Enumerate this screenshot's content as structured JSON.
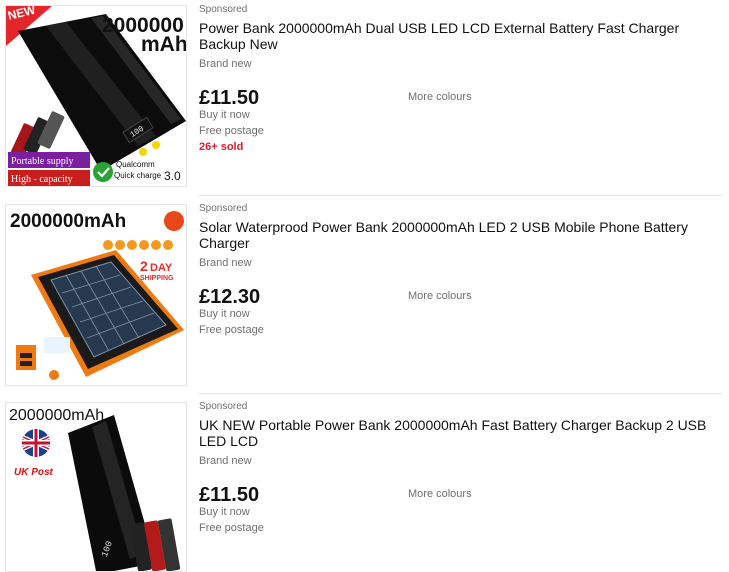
{
  "listings": [
    {
      "sponsored": "Sponsored",
      "title": "Power Bank 2000000mAh Dual USB LED LCD External Battery Fast Charger Backup New",
      "condition": "Brand new",
      "price": "£11.50",
      "format": "Buy it now",
      "postage": "Free postage",
      "sold": "26+ sold",
      "more": "More colours",
      "img": {
        "badge": "NEW",
        "cap_line1": "2000000",
        "cap_line2": "mAh",
        "tag1": "Portable supply",
        "tag2": "High - capacity",
        "qc_brand": "Qualcomm",
        "qc_text": "Quick charge",
        "qc_ver": "3.0",
        "lcd": "100"
      }
    },
    {
      "sponsored": "Sponsored",
      "title": "Solar Waterprood Power Bank 2000000mAh LED 2 USB Mobile Phone Battery Charger",
      "condition": "Brand new",
      "price": "£12.30",
      "format": "Buy it now",
      "postage": "Free postage",
      "more": "More colours",
      "img": {
        "cap": "2000000mAh",
        "day_num": "2",
        "day_word": "DAY",
        "ship_word": "SHIPPING"
      }
    },
    {
      "sponsored": "Sponsored",
      "title": "UK NEW Portable Power Bank 2000000mAh Fast Battery Charger Backup 2 USB LED LCD",
      "condition": "Brand new",
      "price": "£11.50",
      "format": "Buy it now",
      "postage": "Free postage",
      "more": "More colours",
      "img": {
        "cap": "2000000mAh",
        "uk": "UK Post",
        "lcd": "100"
      }
    }
  ]
}
